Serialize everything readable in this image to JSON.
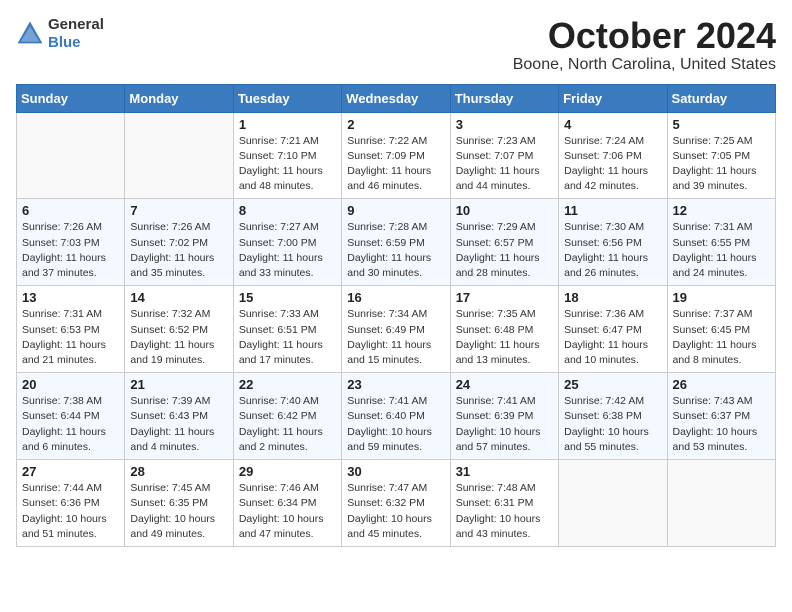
{
  "logo": {
    "general": "General",
    "blue": "Blue"
  },
  "header": {
    "month": "October 2024",
    "location": "Boone, North Carolina, United States"
  },
  "weekdays": [
    "Sunday",
    "Monday",
    "Tuesday",
    "Wednesday",
    "Thursday",
    "Friday",
    "Saturday"
  ],
  "weeks": [
    [
      {
        "day": "",
        "sunrise": "",
        "sunset": "",
        "daylight": ""
      },
      {
        "day": "",
        "sunrise": "",
        "sunset": "",
        "daylight": ""
      },
      {
        "day": "1",
        "sunrise": "Sunrise: 7:21 AM",
        "sunset": "Sunset: 7:10 PM",
        "daylight": "Daylight: 11 hours and 48 minutes."
      },
      {
        "day": "2",
        "sunrise": "Sunrise: 7:22 AM",
        "sunset": "Sunset: 7:09 PM",
        "daylight": "Daylight: 11 hours and 46 minutes."
      },
      {
        "day": "3",
        "sunrise": "Sunrise: 7:23 AM",
        "sunset": "Sunset: 7:07 PM",
        "daylight": "Daylight: 11 hours and 44 minutes."
      },
      {
        "day": "4",
        "sunrise": "Sunrise: 7:24 AM",
        "sunset": "Sunset: 7:06 PM",
        "daylight": "Daylight: 11 hours and 42 minutes."
      },
      {
        "day": "5",
        "sunrise": "Sunrise: 7:25 AM",
        "sunset": "Sunset: 7:05 PM",
        "daylight": "Daylight: 11 hours and 39 minutes."
      }
    ],
    [
      {
        "day": "6",
        "sunrise": "Sunrise: 7:26 AM",
        "sunset": "Sunset: 7:03 PM",
        "daylight": "Daylight: 11 hours and 37 minutes."
      },
      {
        "day": "7",
        "sunrise": "Sunrise: 7:26 AM",
        "sunset": "Sunset: 7:02 PM",
        "daylight": "Daylight: 11 hours and 35 minutes."
      },
      {
        "day": "8",
        "sunrise": "Sunrise: 7:27 AM",
        "sunset": "Sunset: 7:00 PM",
        "daylight": "Daylight: 11 hours and 33 minutes."
      },
      {
        "day": "9",
        "sunrise": "Sunrise: 7:28 AM",
        "sunset": "Sunset: 6:59 PM",
        "daylight": "Daylight: 11 hours and 30 minutes."
      },
      {
        "day": "10",
        "sunrise": "Sunrise: 7:29 AM",
        "sunset": "Sunset: 6:57 PM",
        "daylight": "Daylight: 11 hours and 28 minutes."
      },
      {
        "day": "11",
        "sunrise": "Sunrise: 7:30 AM",
        "sunset": "Sunset: 6:56 PM",
        "daylight": "Daylight: 11 hours and 26 minutes."
      },
      {
        "day": "12",
        "sunrise": "Sunrise: 7:31 AM",
        "sunset": "Sunset: 6:55 PM",
        "daylight": "Daylight: 11 hours and 24 minutes."
      }
    ],
    [
      {
        "day": "13",
        "sunrise": "Sunrise: 7:31 AM",
        "sunset": "Sunset: 6:53 PM",
        "daylight": "Daylight: 11 hours and 21 minutes."
      },
      {
        "day": "14",
        "sunrise": "Sunrise: 7:32 AM",
        "sunset": "Sunset: 6:52 PM",
        "daylight": "Daylight: 11 hours and 19 minutes."
      },
      {
        "day": "15",
        "sunrise": "Sunrise: 7:33 AM",
        "sunset": "Sunset: 6:51 PM",
        "daylight": "Daylight: 11 hours and 17 minutes."
      },
      {
        "day": "16",
        "sunrise": "Sunrise: 7:34 AM",
        "sunset": "Sunset: 6:49 PM",
        "daylight": "Daylight: 11 hours and 15 minutes."
      },
      {
        "day": "17",
        "sunrise": "Sunrise: 7:35 AM",
        "sunset": "Sunset: 6:48 PM",
        "daylight": "Daylight: 11 hours and 13 minutes."
      },
      {
        "day": "18",
        "sunrise": "Sunrise: 7:36 AM",
        "sunset": "Sunset: 6:47 PM",
        "daylight": "Daylight: 11 hours and 10 minutes."
      },
      {
        "day": "19",
        "sunrise": "Sunrise: 7:37 AM",
        "sunset": "Sunset: 6:45 PM",
        "daylight": "Daylight: 11 hours and 8 minutes."
      }
    ],
    [
      {
        "day": "20",
        "sunrise": "Sunrise: 7:38 AM",
        "sunset": "Sunset: 6:44 PM",
        "daylight": "Daylight: 11 hours and 6 minutes."
      },
      {
        "day": "21",
        "sunrise": "Sunrise: 7:39 AM",
        "sunset": "Sunset: 6:43 PM",
        "daylight": "Daylight: 11 hours and 4 minutes."
      },
      {
        "day": "22",
        "sunrise": "Sunrise: 7:40 AM",
        "sunset": "Sunset: 6:42 PM",
        "daylight": "Daylight: 11 hours and 2 minutes."
      },
      {
        "day": "23",
        "sunrise": "Sunrise: 7:41 AM",
        "sunset": "Sunset: 6:40 PM",
        "daylight": "Daylight: 10 hours and 59 minutes."
      },
      {
        "day": "24",
        "sunrise": "Sunrise: 7:41 AM",
        "sunset": "Sunset: 6:39 PM",
        "daylight": "Daylight: 10 hours and 57 minutes."
      },
      {
        "day": "25",
        "sunrise": "Sunrise: 7:42 AM",
        "sunset": "Sunset: 6:38 PM",
        "daylight": "Daylight: 10 hours and 55 minutes."
      },
      {
        "day": "26",
        "sunrise": "Sunrise: 7:43 AM",
        "sunset": "Sunset: 6:37 PM",
        "daylight": "Daylight: 10 hours and 53 minutes."
      }
    ],
    [
      {
        "day": "27",
        "sunrise": "Sunrise: 7:44 AM",
        "sunset": "Sunset: 6:36 PM",
        "daylight": "Daylight: 10 hours and 51 minutes."
      },
      {
        "day": "28",
        "sunrise": "Sunrise: 7:45 AM",
        "sunset": "Sunset: 6:35 PM",
        "daylight": "Daylight: 10 hours and 49 minutes."
      },
      {
        "day": "29",
        "sunrise": "Sunrise: 7:46 AM",
        "sunset": "Sunset: 6:34 PM",
        "daylight": "Daylight: 10 hours and 47 minutes."
      },
      {
        "day": "30",
        "sunrise": "Sunrise: 7:47 AM",
        "sunset": "Sunset: 6:32 PM",
        "daylight": "Daylight: 10 hours and 45 minutes."
      },
      {
        "day": "31",
        "sunrise": "Sunrise: 7:48 AM",
        "sunset": "Sunset: 6:31 PM",
        "daylight": "Daylight: 10 hours and 43 minutes."
      },
      {
        "day": "",
        "sunrise": "",
        "sunset": "",
        "daylight": ""
      },
      {
        "day": "",
        "sunrise": "",
        "sunset": "",
        "daylight": ""
      }
    ]
  ]
}
